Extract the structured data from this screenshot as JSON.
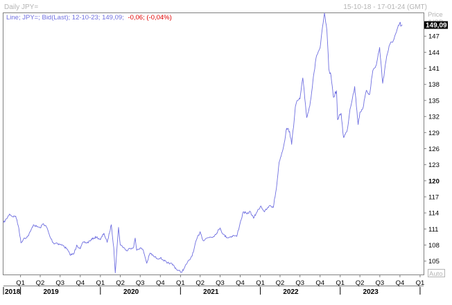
{
  "header": {
    "title": "Daily JPY=",
    "range": "15-10-18 - 17-01-24 (GMT)"
  },
  "legend": {
    "series_label": "Line; JPY=; Bid(Last); 12-10-23; 149,09;",
    "change": "-0,06; (-0,04%)"
  },
  "axis": {
    "unit_line1": "Price",
    "unit_line2": "/USD",
    "last_value": "149,09",
    "auto_label": "Auto"
  },
  "colors": {
    "line": "#6f6fe0",
    "change": "#e00000",
    "frame": "#808080",
    "muted": "#b4b4b4",
    "badge_bg": "#000000",
    "badge_fg": "#ffffff"
  },
  "chart_data": {
    "type": "line",
    "title": "Daily JPY=",
    "x_unit": "date",
    "ylim": [
      102.5,
      151.3
    ],
    "xlim": [
      "2018-10-15",
      "2024-01-17"
    ],
    "y_ticks": [
      {
        "label": "147",
        "value": 147,
        "bold": false
      },
      {
        "label": "144",
        "value": 144,
        "bold": false
      },
      {
        "label": "141",
        "value": 141,
        "bold": false
      },
      {
        "label": "138",
        "value": 138,
        "bold": false
      },
      {
        "label": "135",
        "value": 135,
        "bold": false
      },
      {
        "label": "132",
        "value": 132,
        "bold": false
      },
      {
        "label": "129",
        "value": 129,
        "bold": false
      },
      {
        "label": "126",
        "value": 126,
        "bold": false
      },
      {
        "label": "123",
        "value": 123,
        "bold": false
      },
      {
        "label": "120",
        "value": 120,
        "bold": true
      },
      {
        "label": "117",
        "value": 117,
        "bold": false
      },
      {
        "label": "114",
        "value": 114,
        "bold": false
      },
      {
        "label": "111",
        "value": 111,
        "bold": false
      },
      {
        "label": "108",
        "value": 108,
        "bold": false
      },
      {
        "label": "105",
        "value": 105,
        "bold": false
      }
    ],
    "quarter_ticks": [
      {
        "label": "Q1",
        "date": "2019-01-01"
      },
      {
        "label": "Q2",
        "date": "2019-04-01"
      },
      {
        "label": "Q3",
        "date": "2019-07-01"
      },
      {
        "label": "Q4",
        "date": "2019-10-01"
      },
      {
        "label": "Q1",
        "date": "2020-01-01"
      },
      {
        "label": "Q2",
        "date": "2020-04-01"
      },
      {
        "label": "Q3",
        "date": "2020-07-01"
      },
      {
        "label": "Q4",
        "date": "2020-10-01"
      },
      {
        "label": "Q1",
        "date": "2021-01-01"
      },
      {
        "label": "Q2",
        "date": "2021-04-01"
      },
      {
        "label": "Q3",
        "date": "2021-07-01"
      },
      {
        "label": "Q4",
        "date": "2021-10-01"
      },
      {
        "label": "Q1",
        "date": "2022-01-01"
      },
      {
        "label": "Q2",
        "date": "2022-04-01"
      },
      {
        "label": "Q3",
        "date": "2022-07-01"
      },
      {
        "label": "Q4",
        "date": "2022-10-01"
      },
      {
        "label": "Q1",
        "date": "2023-01-01"
      },
      {
        "label": "Q2",
        "date": "2023-04-01"
      },
      {
        "label": "Q3",
        "date": "2023-07-01"
      },
      {
        "label": "Q4",
        "date": "2023-10-01"
      },
      {
        "label": "Q1",
        "date": "2024-01-01"
      }
    ],
    "year_labels": [
      {
        "label": "2018",
        "date": "2018-10-15"
      },
      {
        "label": "2019",
        "date": "2019-04-15"
      },
      {
        "label": "2020",
        "date": "2020-04-15"
      },
      {
        "label": "2021",
        "date": "2021-04-15"
      },
      {
        "label": "2022",
        "date": "2022-04-15"
      },
      {
        "label": "2023",
        "date": "2023-04-15"
      }
    ],
    "year_boundaries": [
      "2019-01-01",
      "2020-01-01",
      "2021-01-01",
      "2022-01-01",
      "2023-01-01",
      "2024-01-01"
    ],
    "series": [
      {
        "points": [
          [
            "2018-10-15",
            112.2
          ],
          [
            "2018-10-29",
            112.9
          ],
          [
            "2018-11-12",
            113.8
          ],
          [
            "2018-11-26",
            113.3
          ],
          [
            "2018-12-10",
            113.4
          ],
          [
            "2018-12-24",
            111.2
          ],
          [
            "2019-01-03",
            108.4
          ],
          [
            "2019-01-17",
            109.3
          ],
          [
            "2019-02-01",
            109.5
          ],
          [
            "2019-02-15",
            110.5
          ],
          [
            "2019-03-01",
            111.8
          ],
          [
            "2019-03-15",
            111.5
          ],
          [
            "2019-04-01",
            111.2
          ],
          [
            "2019-04-15",
            112.0
          ],
          [
            "2019-05-01",
            111.3
          ],
          [
            "2019-05-15",
            109.6
          ],
          [
            "2019-06-01",
            108.3
          ],
          [
            "2019-06-15",
            108.4
          ],
          [
            "2019-07-01",
            108.1
          ],
          [
            "2019-07-15",
            107.9
          ],
          [
            "2019-08-01",
            107.3
          ],
          [
            "2019-08-15",
            106.2
          ],
          [
            "2019-09-01",
            106.3
          ],
          [
            "2019-09-15",
            108.0
          ],
          [
            "2019-10-01",
            107.3
          ],
          [
            "2019-10-15",
            108.6
          ],
          [
            "2019-11-01",
            108.4
          ],
          [
            "2019-11-15",
            108.8
          ],
          [
            "2019-12-01",
            109.3
          ],
          [
            "2019-12-15",
            109.5
          ],
          [
            "2020-01-01",
            109.0
          ],
          [
            "2020-01-17",
            110.2
          ],
          [
            "2020-02-01",
            108.5
          ],
          [
            "2020-02-20",
            111.8
          ],
          [
            "2020-03-02",
            107.5
          ],
          [
            "2020-03-09",
            102.8
          ],
          [
            "2020-03-16",
            107.0
          ],
          [
            "2020-03-24",
            111.3
          ],
          [
            "2020-04-01",
            108.0
          ],
          [
            "2020-04-15",
            107.6
          ],
          [
            "2020-05-01",
            106.9
          ],
          [
            "2020-05-15",
            107.4
          ],
          [
            "2020-06-01",
            107.6
          ],
          [
            "2020-06-08",
            109.3
          ],
          [
            "2020-06-15",
            107.0
          ],
          [
            "2020-07-01",
            107.5
          ],
          [
            "2020-07-15",
            107.0
          ],
          [
            "2020-07-31",
            104.6
          ],
          [
            "2020-08-15",
            106.5
          ],
          [
            "2020-09-01",
            105.9
          ],
          [
            "2020-09-15",
            105.5
          ],
          [
            "2020-10-01",
            105.6
          ],
          [
            "2020-10-15",
            105.2
          ],
          [
            "2020-11-01",
            104.6
          ],
          [
            "2020-11-15",
            104.6
          ],
          [
            "2020-12-01",
            104.2
          ],
          [
            "2020-12-15",
            103.4
          ],
          [
            "2021-01-05",
            102.9
          ],
          [
            "2021-01-20",
            103.8
          ],
          [
            "2021-02-01",
            104.7
          ],
          [
            "2021-02-15",
            105.4
          ],
          [
            "2021-03-01",
            106.7
          ],
          [
            "2021-03-15",
            109.0
          ],
          [
            "2021-04-01",
            110.5
          ],
          [
            "2021-04-15",
            108.8
          ],
          [
            "2021-05-01",
            109.3
          ],
          [
            "2021-05-15",
            109.5
          ],
          [
            "2021-06-01",
            109.6
          ],
          [
            "2021-06-15",
            110.2
          ],
          [
            "2021-07-01",
            111.2
          ],
          [
            "2021-07-15",
            110.0
          ],
          [
            "2021-08-01",
            109.4
          ],
          [
            "2021-08-15",
            109.5
          ],
          [
            "2021-09-01",
            109.8
          ],
          [
            "2021-09-15",
            109.6
          ],
          [
            "2021-09-30",
            112.0
          ],
          [
            "2021-10-15",
            114.2
          ],
          [
            "2021-11-01",
            113.8
          ],
          [
            "2021-11-15",
            114.3
          ],
          [
            "2021-12-01",
            113.0
          ],
          [
            "2021-12-15",
            114.1
          ],
          [
            "2022-01-03",
            115.3
          ],
          [
            "2022-01-20",
            114.2
          ],
          [
            "2022-02-01",
            114.8
          ],
          [
            "2022-02-15",
            115.4
          ],
          [
            "2022-03-01",
            115.0
          ],
          [
            "2022-03-15",
            118.5
          ],
          [
            "2022-03-28",
            123.5
          ],
          [
            "2022-04-15",
            126.0
          ],
          [
            "2022-05-01",
            129.8
          ],
          [
            "2022-05-15",
            129.2
          ],
          [
            "2022-05-24",
            126.8
          ],
          [
            "2022-06-10",
            133.8
          ],
          [
            "2022-06-20",
            135.0
          ],
          [
            "2022-07-01",
            135.3
          ],
          [
            "2022-07-14",
            139.2
          ],
          [
            "2022-08-01",
            131.8
          ],
          [
            "2022-08-15",
            134.0
          ],
          [
            "2022-09-01",
            139.6
          ],
          [
            "2022-09-15",
            143.4
          ],
          [
            "2022-10-01",
            144.8
          ],
          [
            "2022-10-21",
            151.3
          ],
          [
            "2022-11-01",
            148.1
          ],
          [
            "2022-11-10",
            140.9
          ],
          [
            "2022-11-20",
            139.6
          ],
          [
            "2022-12-01",
            135.6
          ],
          [
            "2022-12-15",
            136.8
          ],
          [
            "2022-12-20",
            131.4
          ],
          [
            "2023-01-05",
            132.6
          ],
          [
            "2023-01-16",
            128.1
          ],
          [
            "2023-02-01",
            129.2
          ],
          [
            "2023-02-15",
            133.4
          ],
          [
            "2023-03-01",
            136.2
          ],
          [
            "2023-03-08",
            137.6
          ],
          [
            "2023-03-24",
            130.5
          ],
          [
            "2023-04-01",
            132.8
          ],
          [
            "2023-04-15",
            133.6
          ],
          [
            "2023-05-01",
            136.9
          ],
          [
            "2023-05-15",
            136.1
          ],
          [
            "2023-05-30",
            140.6
          ],
          [
            "2023-06-15",
            141.6
          ],
          [
            "2023-06-30",
            144.9
          ],
          [
            "2023-07-14",
            138.2
          ],
          [
            "2023-08-01",
            143.2
          ],
          [
            "2023-08-15",
            145.4
          ],
          [
            "2023-09-01",
            146.2
          ],
          [
            "2023-09-15",
            147.8
          ],
          [
            "2023-10-02",
            149.6
          ],
          [
            "2023-10-04",
            148.9
          ],
          [
            "2023-10-12",
            149.09
          ]
        ]
      }
    ]
  }
}
